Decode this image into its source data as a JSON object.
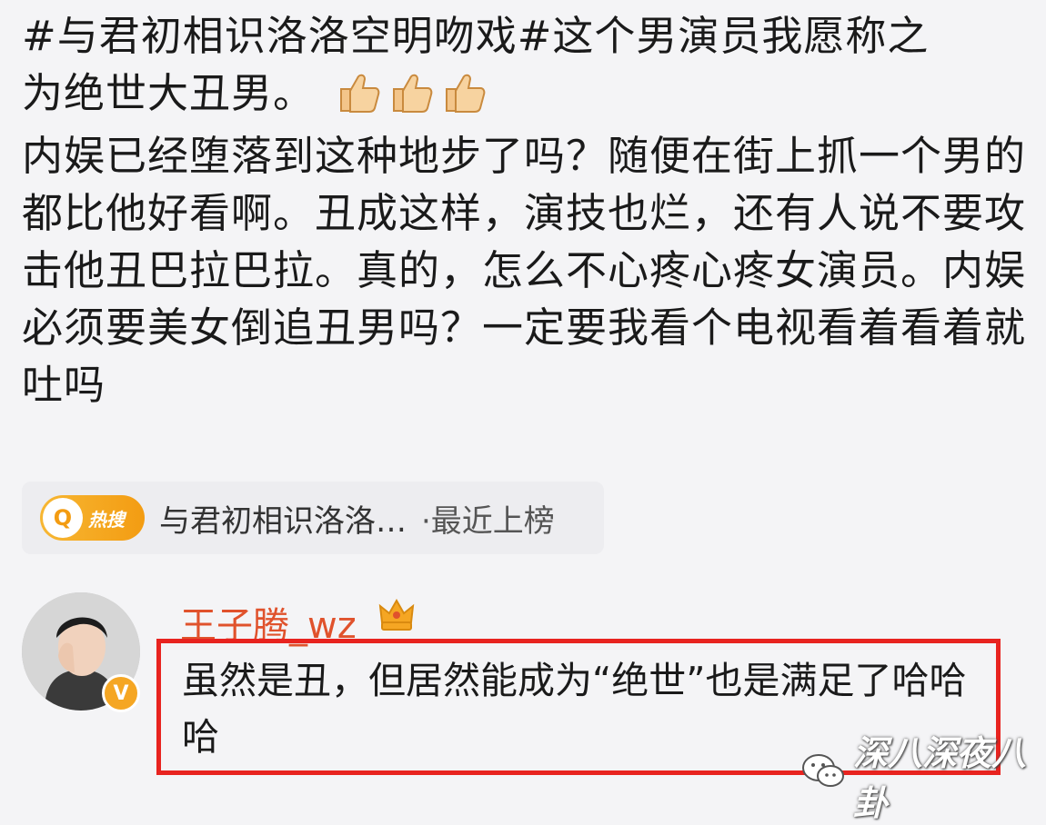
{
  "post": {
    "hashtag": "#与君初相识洛洛空明吻戏#",
    "line_1_rest": "这个男演员我愿称之",
    "line_2": "为绝世大丑男。",
    "paragraph": "内娱已经堕落到这种地步了吗？随便在街上抓一个男的都比他好看啊。丑成这样，演技也烂，还有人说不要攻击他丑巴拉巴拉。真的，怎么不心疼心疼女演员。内娱必须要美女倒追丑男吗？一定要我看个电视看着看着就吐吗",
    "emoji": [
      "thumbs-up-icon",
      "thumbs-up-icon",
      "thumbs-up-icon"
    ]
  },
  "topic_chip": {
    "badge_text": "热搜",
    "badge_icon": "search-icon",
    "title": "与君初相识洛洛…",
    "suffix": "·最近上榜"
  },
  "comment": {
    "username": "王子腾_wz",
    "vip_badge": "crown-icon",
    "text": "虽然是丑，但居然能成为“绝世”也是满足了哈哈哈"
  },
  "watermark": {
    "text": "深八深夜八卦",
    "icon": "wechat-icon"
  },
  "colors": {
    "username": "#e0522c",
    "highlight_border": "#e8231f",
    "badge_gold": "#f5a623"
  }
}
